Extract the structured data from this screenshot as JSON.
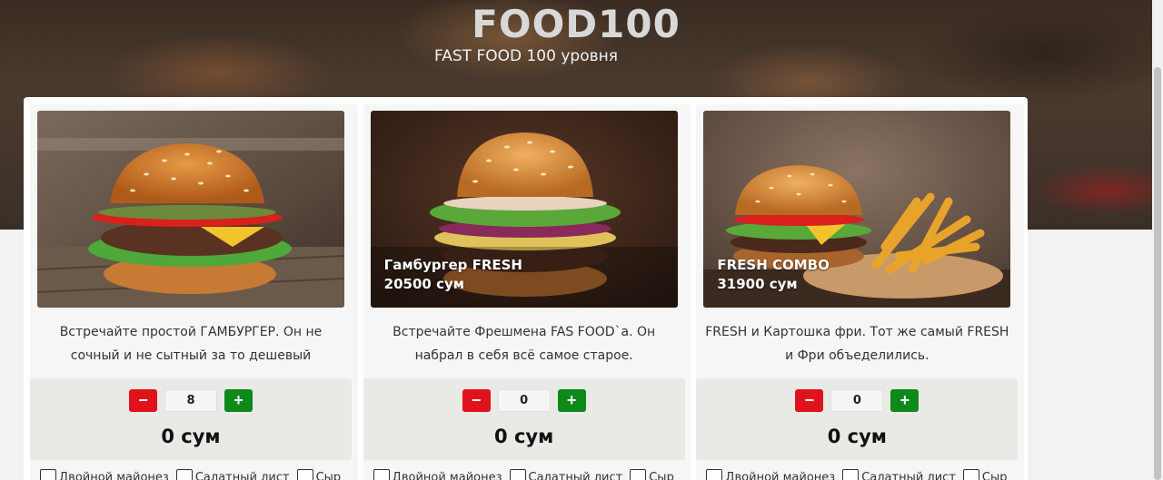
{
  "header": {
    "title": "FOOD100",
    "subtitle": "FAST FOOD 100 уровня"
  },
  "cards": [
    {
      "photo_title": "",
      "photo_price": "",
      "description": "Встречайте простой ГАМБУРГЕР. Он не сочный и не сытный за то дешевый",
      "quantity": "8",
      "total": "0 сум",
      "options": [
        "Двойной майонез",
        "Салатный лист",
        "Сыр"
      ]
    },
    {
      "photo_title": "Гамбургер FRESH",
      "photo_price": "20500 сум",
      "description": "Встречайте Фрешмена FAS FOOD`а. Он набрал в себя всё самое старое.",
      "quantity": "0",
      "total": "0 сум",
      "options": [
        "Двойной майонез",
        "Салатный лист",
        "Сыр"
      ]
    },
    {
      "photo_title": "FRESH COMBO",
      "photo_price": "31900 сум",
      "description": "FRESH и Картошка фри. Тот же самый FRESH и Фри объеделились.",
      "quantity": "0",
      "total": "0 сум",
      "options": [
        "Двойной майонез",
        "Салатный лист",
        "Сыр"
      ]
    }
  ],
  "buttons": {
    "minus": "−",
    "plus": "+"
  },
  "colors": {
    "minus_button": "#e0121b",
    "plus_button": "#0d8a1a"
  }
}
